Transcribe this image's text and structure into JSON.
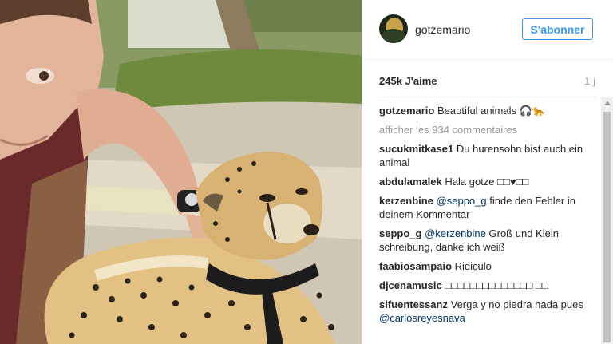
{
  "post": {
    "username": "gotzemario",
    "follow_label": "S'abonner",
    "likes": "245k J'aime",
    "time": "1 j"
  },
  "caption": {
    "user": "gotzemario",
    "text": "Beautiful animals 🎧🐆"
  },
  "more_comments": "afficher les 934 commentaires",
  "comments": [
    {
      "user": "sucukmitkase1",
      "text": "Du hurensohn bist auch ein animal"
    },
    {
      "user": "abdulamalek",
      "text": "Hala gotze □□♥□□"
    },
    {
      "user": "kerzenbine",
      "mention": "@seppo_g",
      "text": "finde den Fehler in deinem Kommentar"
    },
    {
      "user": "seppo_g",
      "mention": "@kerzenbine",
      "text": "Groß und Klein schreibung, danke ich weiß"
    },
    {
      "user": "faabiosampaio",
      "text": "Ridiculo"
    },
    {
      "user": "djcenamusic",
      "text": "□□□□□□□□□□□□□□ □□"
    },
    {
      "user": "sifuentessanz",
      "text": "Verga y no piedra nada pues",
      "mention_after": "@carlosreyesnava"
    }
  ],
  "colors": {
    "accent": "#3897f0",
    "mention": "#003569",
    "muted": "#999999",
    "text": "#262626"
  }
}
